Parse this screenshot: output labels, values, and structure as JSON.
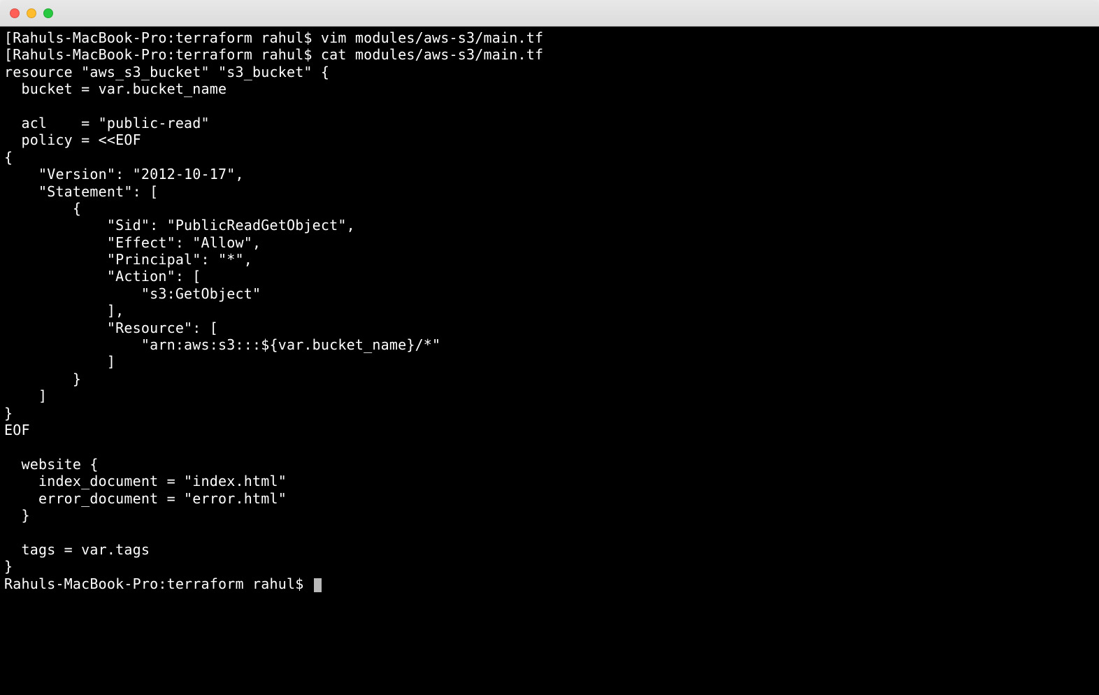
{
  "titlebar": {
    "close_icon": "close-icon",
    "minimize_icon": "minimize-icon",
    "maximize_icon": "maximize-icon"
  },
  "session": {
    "prompt1": "[Rahuls-MacBook-Pro:terraform rahul$ ",
    "cmd1": "vim modules/aws-s3/main.tf",
    "prompt2": "[Rahuls-MacBook-Pro:terraform rahul$ ",
    "cmd2": "cat modules/aws-s3/main.tf",
    "output": "resource \"aws_s3_bucket\" \"s3_bucket\" {\n  bucket = var.bucket_name\n\n  acl    = \"public-read\"\n  policy = <<EOF\n{\n    \"Version\": \"2012-10-17\",\n    \"Statement\": [\n        {\n            \"Sid\": \"PublicReadGetObject\",\n            \"Effect\": \"Allow\",\n            \"Principal\": \"*\",\n            \"Action\": [\n                \"s3:GetObject\"\n            ],\n            \"Resource\": [\n                \"arn:aws:s3:::${var.bucket_name}/*\"\n            ]\n        }\n    ]\n}\nEOF\n\n  website {\n    index_document = \"index.html\"\n    error_document = \"error.html\"\n  }\n\n  tags = var.tags\n}",
    "prompt3": "Rahuls-MacBook-Pro:terraform rahul$ "
  }
}
